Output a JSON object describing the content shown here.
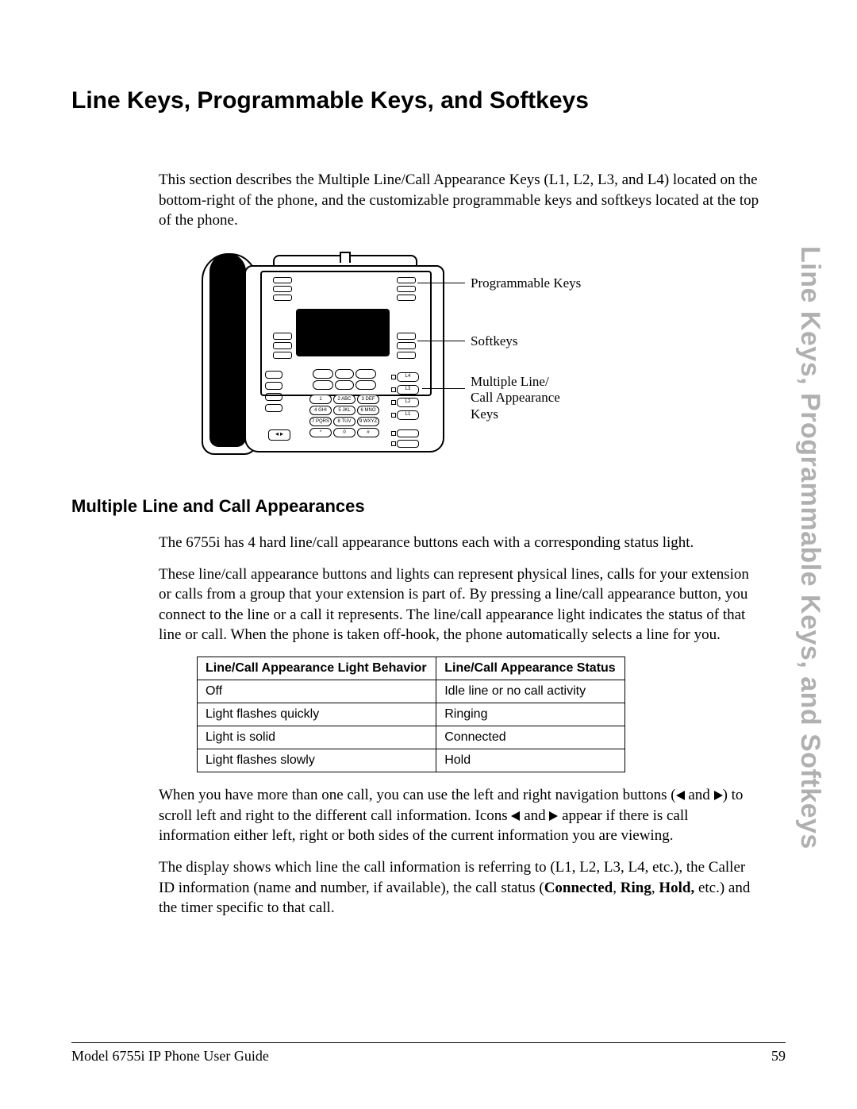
{
  "title": "Line Keys, Programmable Keys, and Softkeys",
  "side_title": "Line Keys, Programmable Keys, and Softkeys",
  "intro": "This section describes the Multiple Line/Call Appearance Keys (L1, L2, L3, and L4) located on the bottom-right of the phone, and the customizable programmable keys and softkeys located at the top of the phone.",
  "diagram": {
    "labels": {
      "programmable": "Programmable Keys",
      "softkeys": "Softkeys",
      "multiline": "Multiple Line/\nCall Appearance\nKeys"
    },
    "line_keys": [
      "L4",
      "L3",
      "L2",
      "L1"
    ],
    "keypad": [
      "1",
      "2 ABC",
      "3 DEF",
      "4 GHI",
      "5 JKL",
      "6 MNO",
      "7 PQRS",
      "8 TUV",
      "9 WXYZ",
      "*",
      "0",
      "#"
    ]
  },
  "subhead": "Multiple Line and Call Appearances",
  "p1": "The 6755i has 4 hard line/call appearance buttons each with a corresponding status light.",
  "p2": "These line/call appearance buttons and lights can represent physical lines, calls for your extension or calls from a group that your extension is part of. By pressing a line/call appearance button, you connect to the line or a call it represents. The line/call appearance light indicates the status of that line or call. When the phone is taken off-hook, the phone automatically selects a line for you.",
  "table": {
    "headers": [
      "Line/Call Appearance Light Behavior",
      "Line/Call Appearance Status"
    ],
    "rows": [
      [
        "Off",
        "Idle line or no call activity"
      ],
      [
        "Light flashes quickly",
        "Ringing"
      ],
      [
        "Light is solid",
        "Connected"
      ],
      [
        "Light flashes slowly",
        "Hold"
      ]
    ]
  },
  "p3_a": "When you have more than one call, you can use the left and right navigation buttons (",
  "p3_b": " and ",
  "p3_c": ") to scroll left and right to the different call information. Icons ",
  "p3_d": " and ",
  "p3_e": " appear if there is call information either left, right or both sides of the current information you are viewing.",
  "p4_a": "The display shows which line the call information is referring to (L1, L2, L3, L4, etc.), the Caller ID information (name and number, if available), the call status (",
  "p4_b": "Connected",
  "p4_c": ", ",
  "p4_d": "Ring",
  "p4_e": ", ",
  "p4_f": "Hold,",
  "p4_g": " etc.) and the timer specific to that call.",
  "footer": {
    "left": "Model 6755i IP Phone User Guide",
    "page": "59"
  }
}
